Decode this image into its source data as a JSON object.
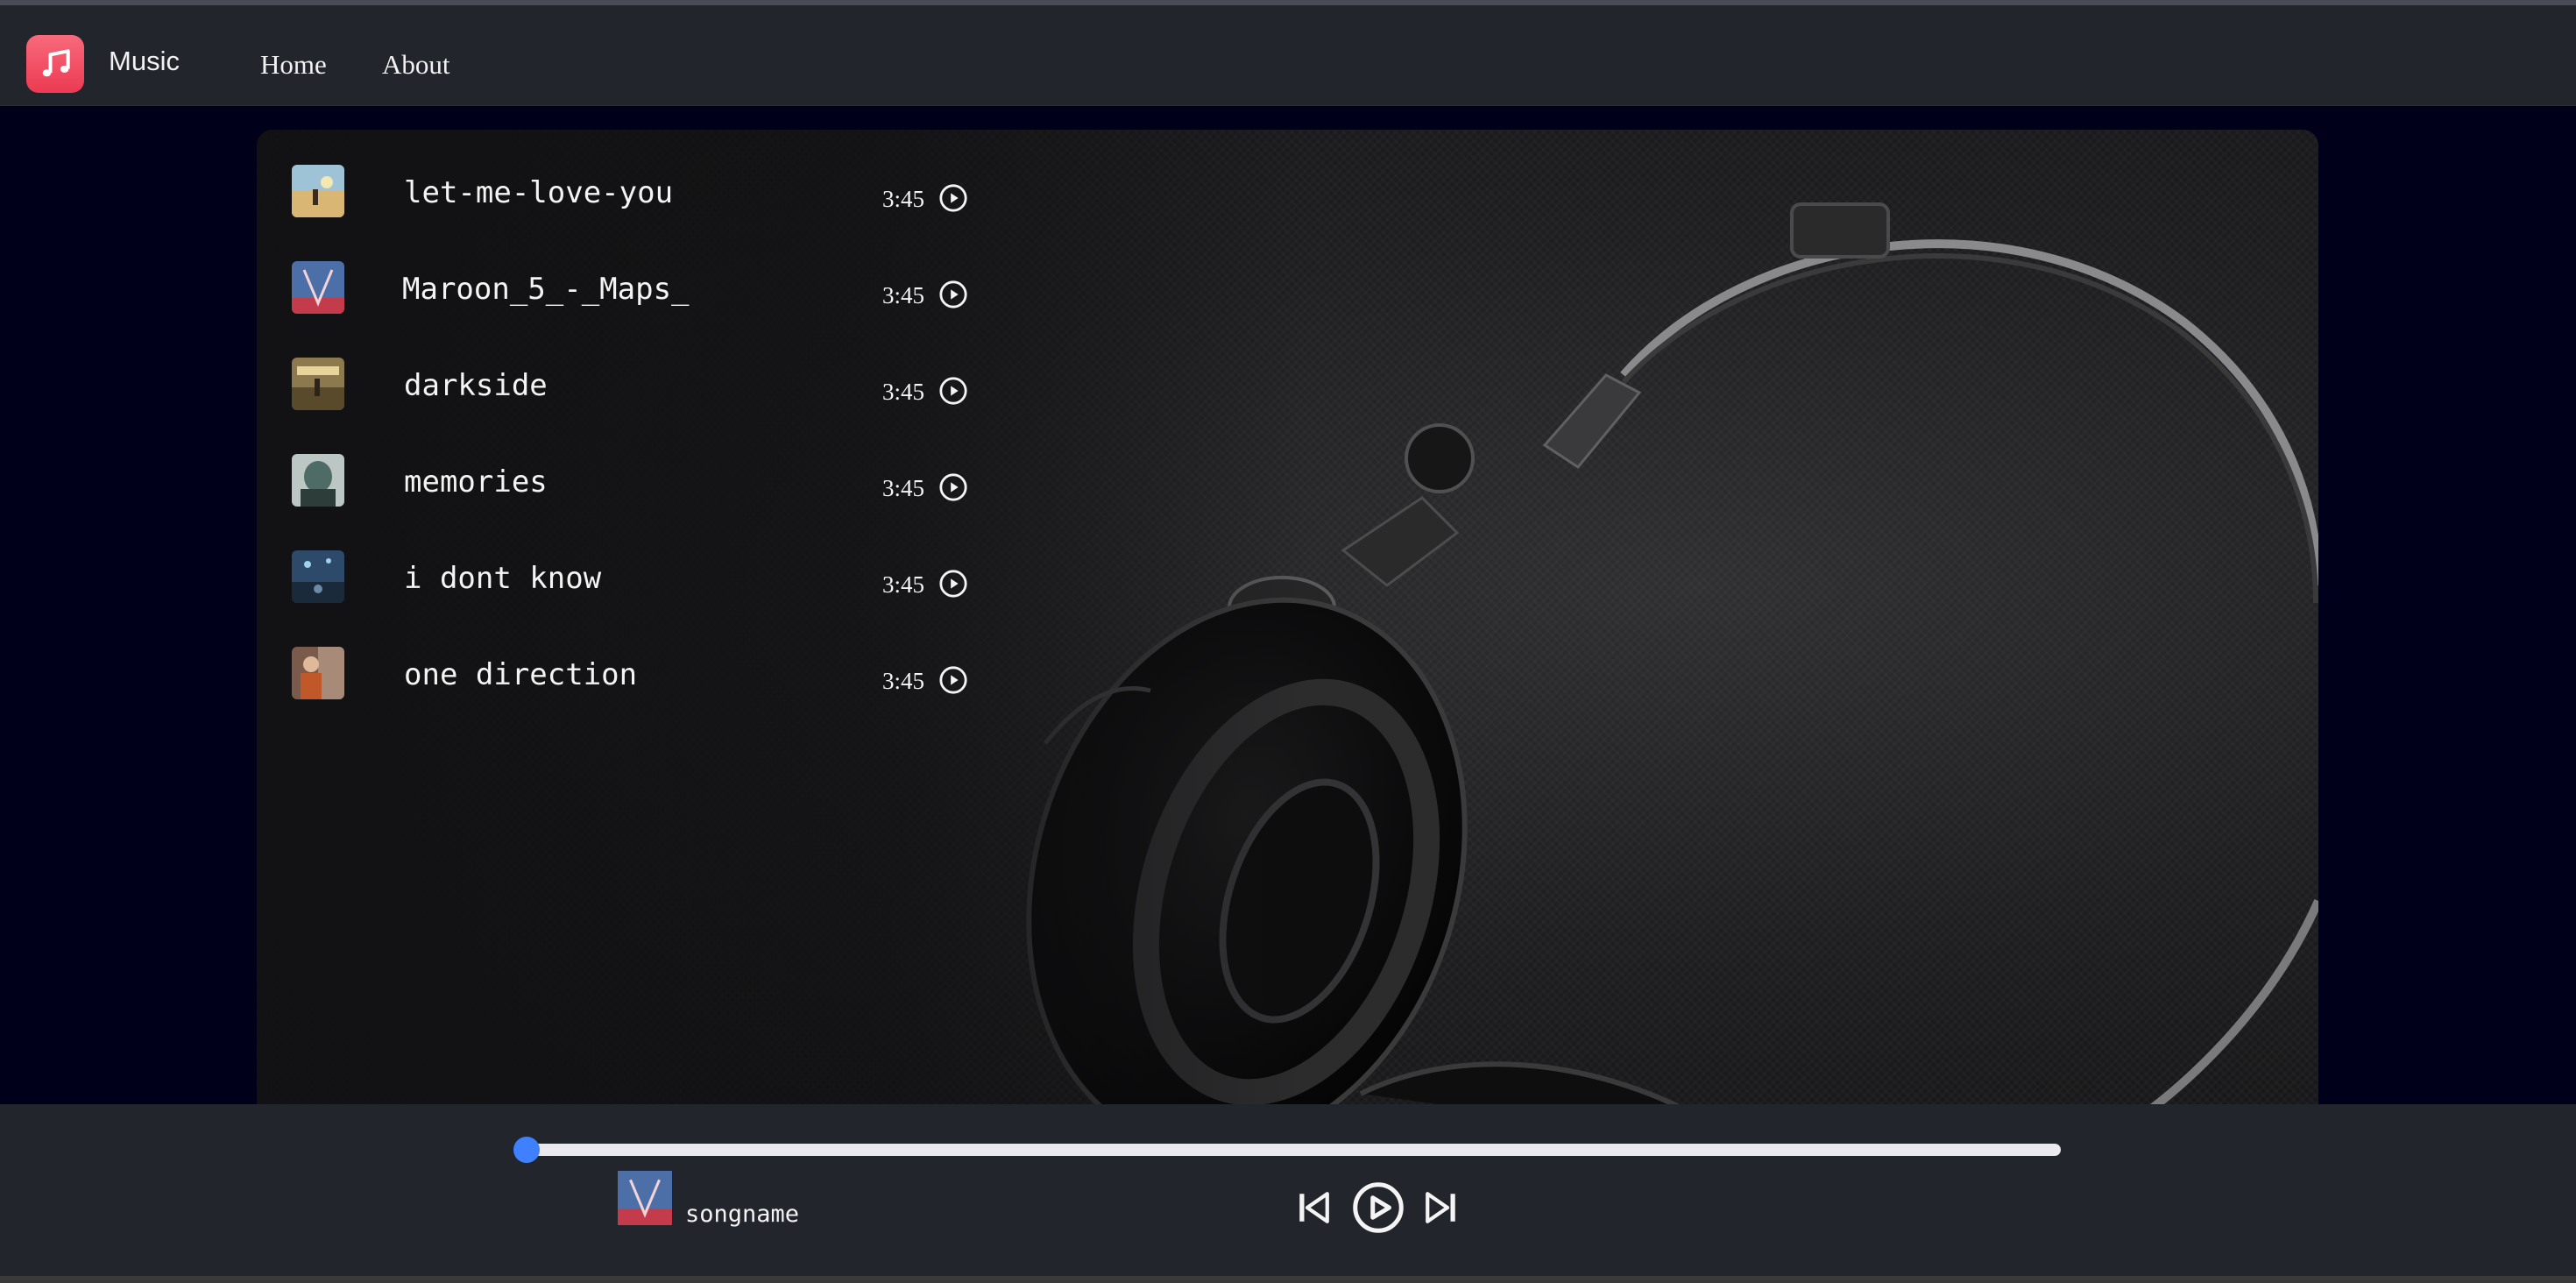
{
  "app": {
    "title": "Music"
  },
  "nav": {
    "home": "Home",
    "about": "About"
  },
  "songs": [
    {
      "name": "let-me-love-you",
      "duration": "3:45"
    },
    {
      "name": "Maroon_5_-_Maps_",
      "duration": "3:45"
    },
    {
      "name": "darkside",
      "duration": "3:45"
    },
    {
      "name": "memories",
      "duration": "3:45"
    },
    {
      "name": "i dont know",
      "duration": "3:45"
    },
    {
      "name": "one direction",
      "duration": "3:45"
    }
  ],
  "player": {
    "song_name": "songname",
    "progress": 0
  },
  "colors": {
    "accent": "#3f80ff",
    "logo": "#ec3a52",
    "navbar": "#22252c",
    "page_bg": "#00001a"
  },
  "icons": [
    "music-note-icon",
    "play-circle-icon",
    "skip-back-icon",
    "play-icon",
    "skip-forward-icon"
  ]
}
